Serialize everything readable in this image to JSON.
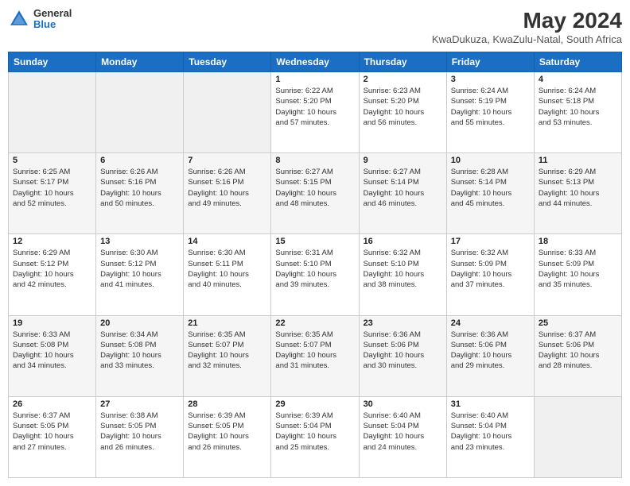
{
  "logo": {
    "general": "General",
    "blue": "Blue"
  },
  "header": {
    "title": "May 2024",
    "subtitle": "KwaDukuza, KwaZulu-Natal, South Africa"
  },
  "days_of_week": [
    "Sunday",
    "Monday",
    "Tuesday",
    "Wednesday",
    "Thursday",
    "Friday",
    "Saturday"
  ],
  "weeks": [
    [
      {
        "day": "",
        "info": ""
      },
      {
        "day": "",
        "info": ""
      },
      {
        "day": "",
        "info": ""
      },
      {
        "day": "1",
        "info": "Sunrise: 6:22 AM\nSunset: 5:20 PM\nDaylight: 10 hours\nand 57 minutes."
      },
      {
        "day": "2",
        "info": "Sunrise: 6:23 AM\nSunset: 5:20 PM\nDaylight: 10 hours\nand 56 minutes."
      },
      {
        "day": "3",
        "info": "Sunrise: 6:24 AM\nSunset: 5:19 PM\nDaylight: 10 hours\nand 55 minutes."
      },
      {
        "day": "4",
        "info": "Sunrise: 6:24 AM\nSunset: 5:18 PM\nDaylight: 10 hours\nand 53 minutes."
      }
    ],
    [
      {
        "day": "5",
        "info": "Sunrise: 6:25 AM\nSunset: 5:17 PM\nDaylight: 10 hours\nand 52 minutes."
      },
      {
        "day": "6",
        "info": "Sunrise: 6:26 AM\nSunset: 5:16 PM\nDaylight: 10 hours\nand 50 minutes."
      },
      {
        "day": "7",
        "info": "Sunrise: 6:26 AM\nSunset: 5:16 PM\nDaylight: 10 hours\nand 49 minutes."
      },
      {
        "day": "8",
        "info": "Sunrise: 6:27 AM\nSunset: 5:15 PM\nDaylight: 10 hours\nand 48 minutes."
      },
      {
        "day": "9",
        "info": "Sunrise: 6:27 AM\nSunset: 5:14 PM\nDaylight: 10 hours\nand 46 minutes."
      },
      {
        "day": "10",
        "info": "Sunrise: 6:28 AM\nSunset: 5:14 PM\nDaylight: 10 hours\nand 45 minutes."
      },
      {
        "day": "11",
        "info": "Sunrise: 6:29 AM\nSunset: 5:13 PM\nDaylight: 10 hours\nand 44 minutes."
      }
    ],
    [
      {
        "day": "12",
        "info": "Sunrise: 6:29 AM\nSunset: 5:12 PM\nDaylight: 10 hours\nand 42 minutes."
      },
      {
        "day": "13",
        "info": "Sunrise: 6:30 AM\nSunset: 5:12 PM\nDaylight: 10 hours\nand 41 minutes."
      },
      {
        "day": "14",
        "info": "Sunrise: 6:30 AM\nSunset: 5:11 PM\nDaylight: 10 hours\nand 40 minutes."
      },
      {
        "day": "15",
        "info": "Sunrise: 6:31 AM\nSunset: 5:10 PM\nDaylight: 10 hours\nand 39 minutes."
      },
      {
        "day": "16",
        "info": "Sunrise: 6:32 AM\nSunset: 5:10 PM\nDaylight: 10 hours\nand 38 minutes."
      },
      {
        "day": "17",
        "info": "Sunrise: 6:32 AM\nSunset: 5:09 PM\nDaylight: 10 hours\nand 37 minutes."
      },
      {
        "day": "18",
        "info": "Sunrise: 6:33 AM\nSunset: 5:09 PM\nDaylight: 10 hours\nand 35 minutes."
      }
    ],
    [
      {
        "day": "19",
        "info": "Sunrise: 6:33 AM\nSunset: 5:08 PM\nDaylight: 10 hours\nand 34 minutes."
      },
      {
        "day": "20",
        "info": "Sunrise: 6:34 AM\nSunset: 5:08 PM\nDaylight: 10 hours\nand 33 minutes."
      },
      {
        "day": "21",
        "info": "Sunrise: 6:35 AM\nSunset: 5:07 PM\nDaylight: 10 hours\nand 32 minutes."
      },
      {
        "day": "22",
        "info": "Sunrise: 6:35 AM\nSunset: 5:07 PM\nDaylight: 10 hours\nand 31 minutes."
      },
      {
        "day": "23",
        "info": "Sunrise: 6:36 AM\nSunset: 5:06 PM\nDaylight: 10 hours\nand 30 minutes."
      },
      {
        "day": "24",
        "info": "Sunrise: 6:36 AM\nSunset: 5:06 PM\nDaylight: 10 hours\nand 29 minutes."
      },
      {
        "day": "25",
        "info": "Sunrise: 6:37 AM\nSunset: 5:06 PM\nDaylight: 10 hours\nand 28 minutes."
      }
    ],
    [
      {
        "day": "26",
        "info": "Sunrise: 6:37 AM\nSunset: 5:05 PM\nDaylight: 10 hours\nand 27 minutes."
      },
      {
        "day": "27",
        "info": "Sunrise: 6:38 AM\nSunset: 5:05 PM\nDaylight: 10 hours\nand 26 minutes."
      },
      {
        "day": "28",
        "info": "Sunrise: 6:39 AM\nSunset: 5:05 PM\nDaylight: 10 hours\nand 26 minutes."
      },
      {
        "day": "29",
        "info": "Sunrise: 6:39 AM\nSunset: 5:04 PM\nDaylight: 10 hours\nand 25 minutes."
      },
      {
        "day": "30",
        "info": "Sunrise: 6:40 AM\nSunset: 5:04 PM\nDaylight: 10 hours\nand 24 minutes."
      },
      {
        "day": "31",
        "info": "Sunrise: 6:40 AM\nSunset: 5:04 PM\nDaylight: 10 hours\nand 23 minutes."
      },
      {
        "day": "",
        "info": ""
      }
    ]
  ]
}
